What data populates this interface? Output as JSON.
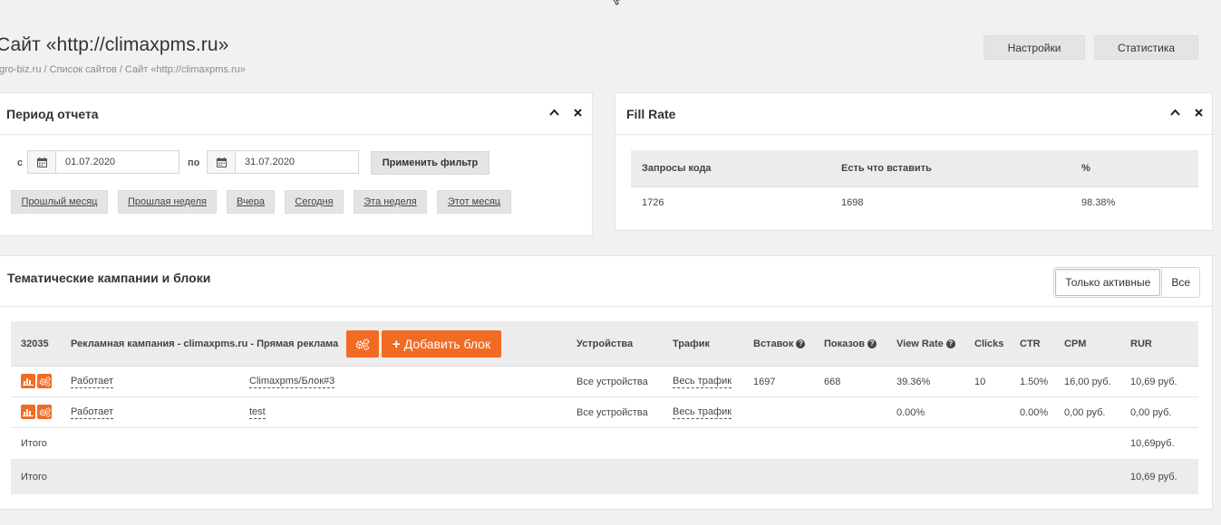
{
  "header": {
    "title": "Сайт «http://climaxpms.ru»",
    "breadcrumb": [
      "gro-biz.ru",
      "Список сайтов",
      "Сайт «http://climaxpms.ru»"
    ],
    "breadcrumb_sep": "/",
    "settings_label": "Настройки",
    "stats_label": "Статистика"
  },
  "period": {
    "title": "Период отчета",
    "from_label": "с",
    "to_label": "по",
    "date_from": "01.07.2020",
    "date_to": "31.07.2020",
    "apply_label": "Применить фильтр",
    "quick": [
      "Прошлый месяц",
      "Прошлая неделя",
      "Вчера",
      "Сегодня",
      "Эта неделя",
      "Этот месяц"
    ]
  },
  "fill_rate": {
    "title": "Fill Rate",
    "columns": [
      "Запросы кода",
      "Есть что вставить",
      "%"
    ],
    "row": [
      "1726",
      "1698",
      "98.38%"
    ]
  },
  "campaigns": {
    "title": "Тематические кампании и блоки",
    "filter_active": "Только активные",
    "filter_all": "Все",
    "campaign_id": "32035",
    "campaign_name": "Рекламная кампания - climaxpms.ru - Прямая реклама",
    "add_block_label": "Добавить блок",
    "columns": {
      "devices": "Устройства",
      "traffic": "Трафик",
      "inserts": "Вставок",
      "shows": "Показов",
      "view_rate": "View Rate",
      "clicks": "Clicks",
      "ctr": "CTR",
      "cpm": "CPM",
      "rur": "RUR"
    },
    "rows": [
      {
        "status": "Работает",
        "block": "Climaxpms/Блок#3",
        "devices": "Все устройства",
        "traffic": "Весь трафик",
        "inserts": "1697",
        "shows": "668",
        "view_rate": "39.36%",
        "clicks": "10",
        "ctr": "1.50%",
        "cpm": "16,00 руб.",
        "rur": "10,69 руб."
      },
      {
        "status": "Работает",
        "block": "test",
        "devices": "Все устройства",
        "traffic": "Весь трафик",
        "inserts": "",
        "shows": "",
        "view_rate": "0.00%",
        "clicks": "",
        "ctr": "0.00%",
        "cpm": "0,00 руб.",
        "rur": "0,00 руб."
      }
    ],
    "total_label": "Итого",
    "total_rur": "10,69руб.",
    "grand_total_label": "Итого",
    "grand_total_rur": "10,69 руб."
  },
  "colors": {
    "accent": "#f26b22",
    "background": "#f1f1f1",
    "header_row": "#ececec"
  }
}
